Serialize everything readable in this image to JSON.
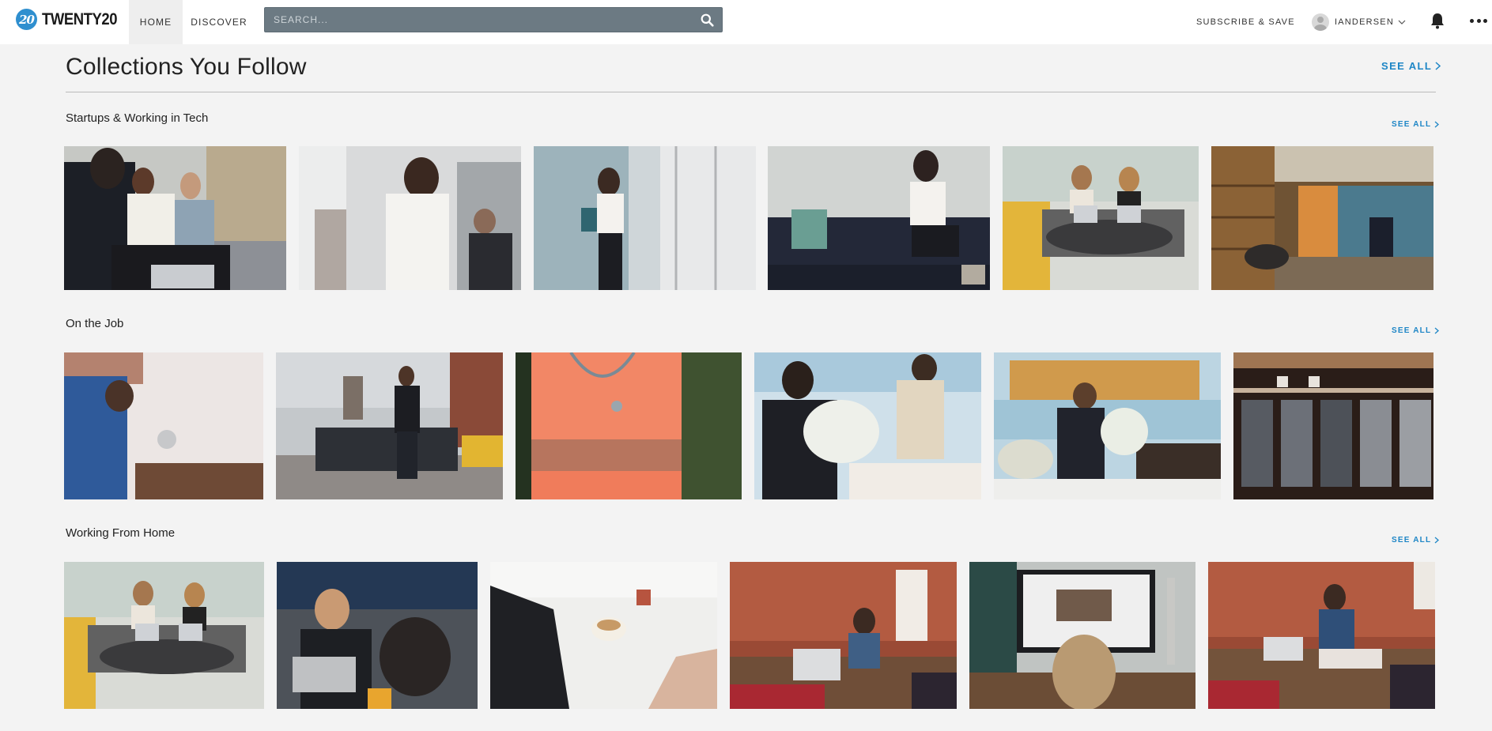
{
  "nav": {
    "logo_badge": "20",
    "logo_text": "TWENTY20",
    "home": "HOME",
    "discover": "DISCOVER",
    "search_placeholder": "SEARCH...",
    "subscribe": "SUBSCRIBE & SAVE",
    "username": "IANDERSEN"
  },
  "page": {
    "title": "Collections You Follow",
    "see_all": "SEE ALL"
  },
  "collections": [
    {
      "title": "Startups & Working in Tech",
      "see_all": "SEE ALL",
      "photos": [
        "team-meeting-laptop",
        "woman-glasses-presenting",
        "woman-reading-phone-window",
        "woman-sitting-sofa",
        "two-women-laptops-perk",
        "office-hallway-bookshelves"
      ]
    },
    {
      "title": "On the Job",
      "see_all": "SEE ALL",
      "photos": [
        "worker-fixing-pipe",
        "man-standing-by-taxi",
        "nurse-stethoscope",
        "florists-arranging",
        "florist-bouquet",
        "locker-room-jerseys"
      ]
    },
    {
      "title": "Working From Home",
      "see_all": "SEE ALL",
      "photos": [
        "two-women-laptops-perk",
        "smiling-man-laptop",
        "hand-writing-coffee",
        "seamstress-brick-wall",
        "person-at-imac",
        "seamstress-sewing"
      ]
    }
  ],
  "colors": {
    "accent": "#1e86c6",
    "background": "#f3f3f3",
    "search_bg": "#6c7a83"
  }
}
